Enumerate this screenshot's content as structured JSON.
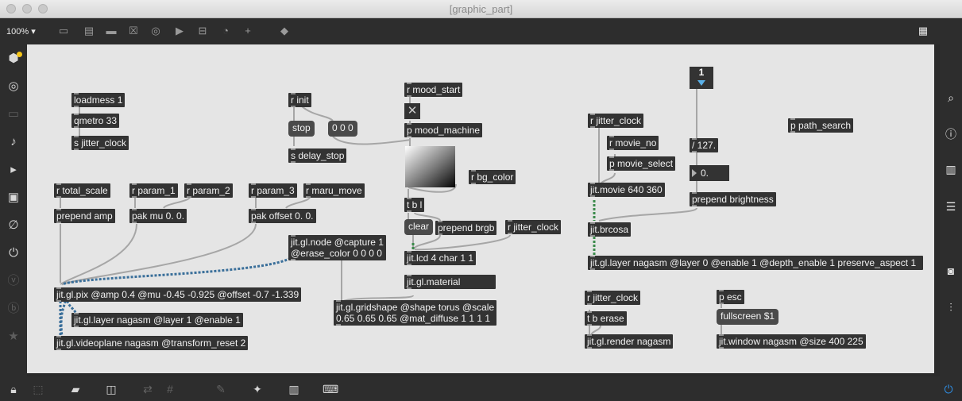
{
  "window": {
    "title": "[graphic_part]"
  },
  "toolbar": {
    "zoom": "100%",
    "zoom_caret": "▾"
  },
  "patch": {
    "loadmess": "loadmess 1",
    "qmetro": "qmetro 33",
    "s_jitter_clock": "s jitter_clock",
    "r_init": "r init",
    "stop_msg": "stop",
    "zeros_msg": "0 0 0",
    "s_delay_stop": "s delay_stop",
    "r_mood_start": "r mood_start",
    "p_mood_machine": "p mood_machine",
    "r_bg_color": "r bg_color",
    "tbl": "t b l",
    "clear_msg": "clear",
    "prepend_brgb": "prepend brgb",
    "r_jitter_clock_mid": "r jitter_clock",
    "jit_lcd": "jit.lcd 4 char 1 1",
    "jit_gl_material": "jit.gl.material",
    "r_total_scale": "r total_scale",
    "r_param_1": "r param_1",
    "r_param_2": "r param_2",
    "r_param_3": "r param_3",
    "r_maru_move": "r maru_move",
    "prepend_amp": "prepend amp",
    "pak_mu": "pak mu 0. 0.",
    "pak_offset": "pak offset 0. 0.",
    "jit_gl_node": "jit.gl.node @capture 1\n@erase_color 0 0 0 0",
    "jit_gl_pix": "jit.gl.pix @amp 0.4 @mu -0.45 -0.925 @offset -0.7 -1.339",
    "jit_gl_layer_1": "jit.gl.layer nagasm @layer 1 @enable 1",
    "jit_gl_videoplane": "jit.gl.videoplane nagasm @transform_reset 2",
    "jit_gl_gridshape": "jit.gl.gridshape @shape torus @scale\n0.65 0.65 0.65 @mat_diffuse 1 1 1 1",
    "r_jitter_clock_right": "r jitter_clock",
    "r_movie_no": "r movie_no",
    "p_movie_select": "p movie_select",
    "jit_movie": "jit.movie 640 360",
    "jit_brcosa": "jit.brcosa",
    "jit_gl_layer_0": "jit.gl.layer nagasm @layer 0 @enable 1 @depth_enable 1 preserve_aspect 1",
    "int_box": "1",
    "div127": "/ 127.",
    "float_box": "0.",
    "prepend_brightness": "prepend brightness",
    "p_path_search": "p path_search",
    "r_jitter_clock_bottom": "r jitter_clock",
    "t_b_erase": "t b erase",
    "jit_gl_render": "jit.gl.render nagasm",
    "p_esc": "p esc",
    "fullscreen_msg": "fullscreen $1",
    "jit_window": "jit.window nagasm @size 400 225"
  },
  "colors": {
    "canvas": "#e5e5e5",
    "object": "#333333",
    "message": "#4a4a4a",
    "patch_cord": "#a6a6a6",
    "matrix_cord": "#3a8a4a",
    "gl_cord": "#3a6f9a",
    "accent_yellow": "#f5c518",
    "power_blue": "#2f8fe6"
  },
  "icons": {
    "left": [
      "package-manager-icon",
      "target-icon",
      "clipboard-icon",
      "music-note-icon",
      "video-play-icon",
      "image-icon",
      "paperclip-icon",
      "plug-icon",
      "v-icon",
      "b-icon",
      "star-icon"
    ],
    "right": [
      "search-icon",
      "info-icon",
      "book-icon",
      "list-icon",
      "camera-icon",
      "sliders-icon"
    ]
  }
}
